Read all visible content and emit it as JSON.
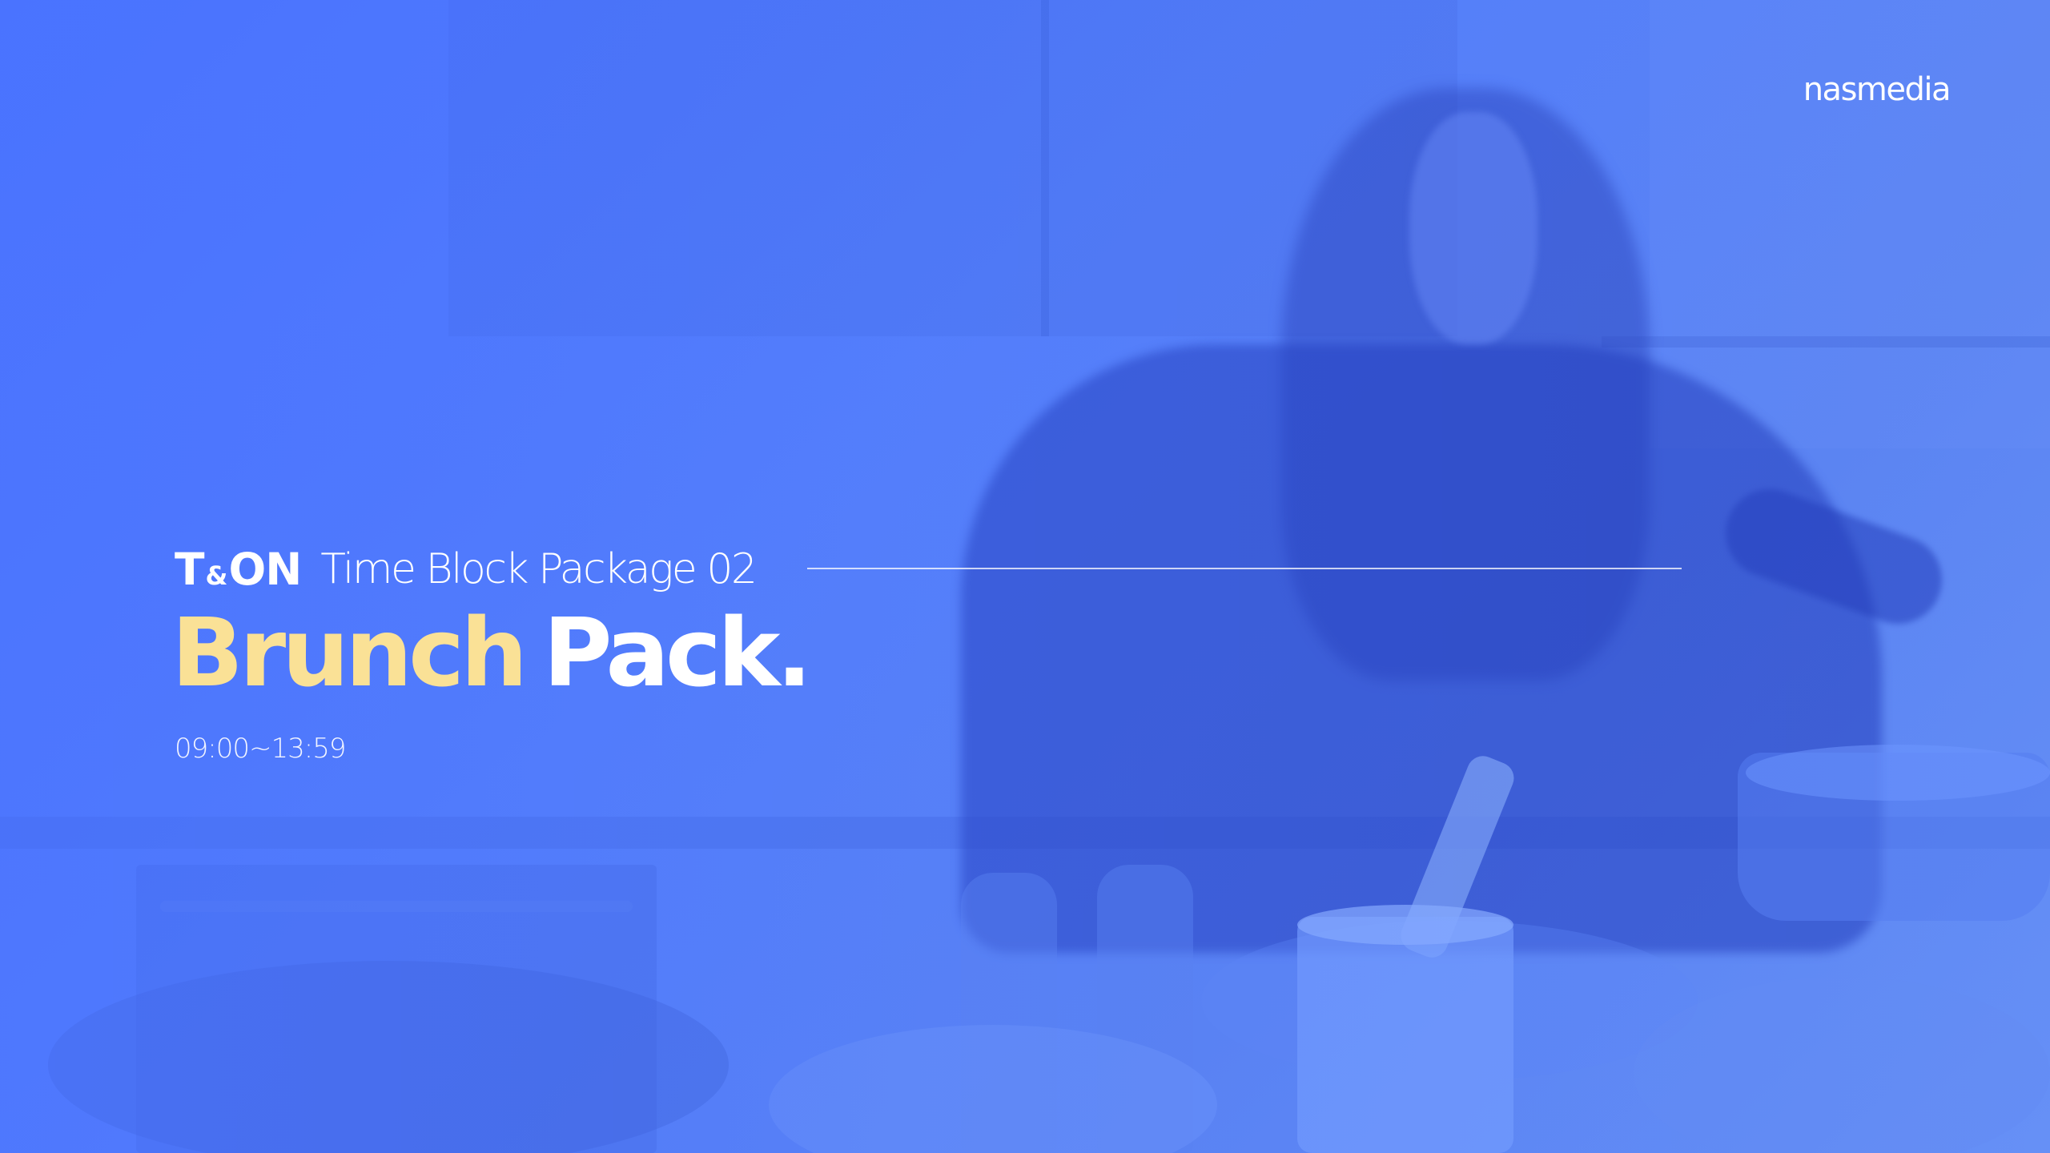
{
  "brand": {
    "logo_text": "nasmedia"
  },
  "product_logo": {
    "part1": "T",
    "ampersand": "&",
    "part2": "ON"
  },
  "header": {
    "package_title": "Time Block Package 02"
  },
  "title": {
    "accent_word": "Brunch",
    "rest": "Pack."
  },
  "time_range": "09:00~13:59",
  "colors": {
    "background": "#4a72f5",
    "accent": "#fae196",
    "text": "#ffffff"
  }
}
